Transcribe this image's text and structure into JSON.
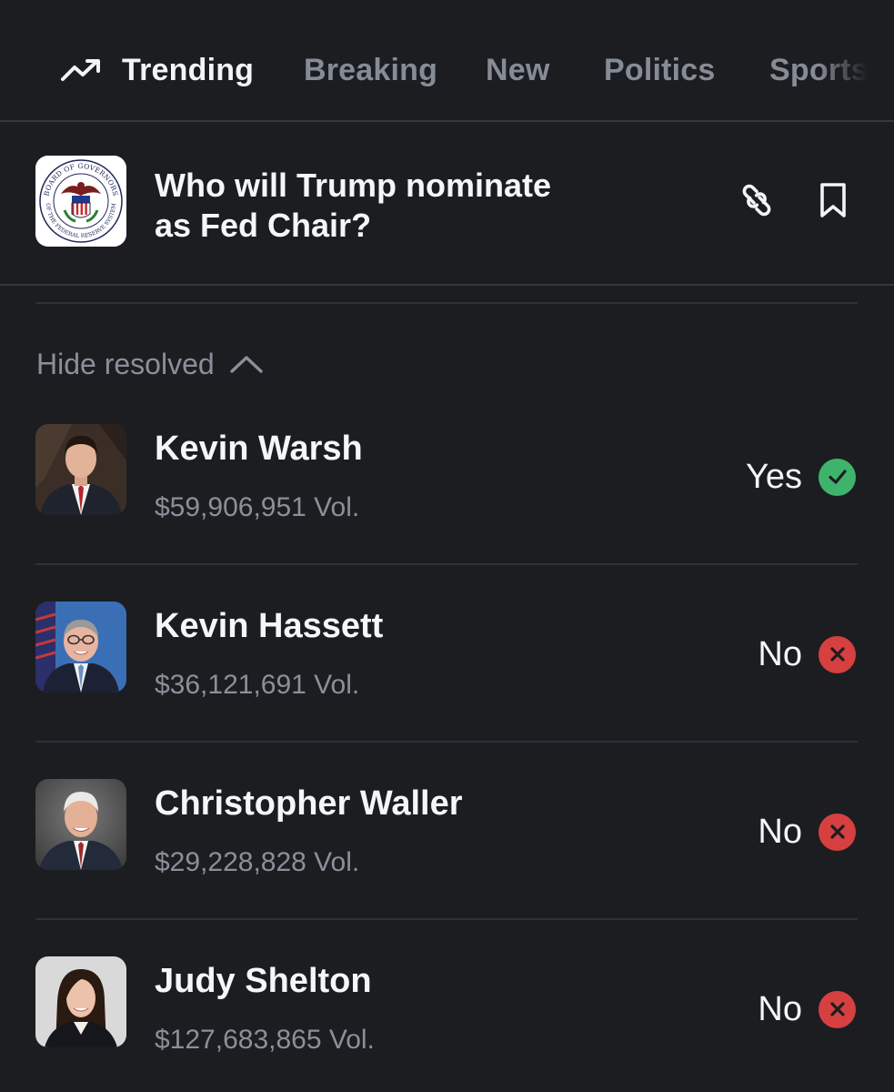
{
  "tabs": [
    {
      "label": "Trending",
      "active": true,
      "icon": "trending-up-icon"
    },
    {
      "label": "Breaking",
      "active": false
    },
    {
      "label": "New",
      "active": false
    },
    {
      "label": "Politics",
      "active": false
    },
    {
      "label": "Sports",
      "active": false
    }
  ],
  "market": {
    "title": "Who will Trump nominate as Fed Chair?",
    "logo": "federal-reserve-seal",
    "logo_text_top": "BOARD OF GOVERNORS",
    "logo_text_bottom": "OF THE FEDERAL RESERVE SYSTEM",
    "actions": [
      "link-icon",
      "bookmark-icon"
    ]
  },
  "filter": {
    "label": "Hide resolved",
    "icon": "chevron-up-icon"
  },
  "outcomes": [
    {
      "name": "Kevin Warsh",
      "volume": "$59,906,951 Vol.",
      "result": "Yes",
      "status": "resolved-yes"
    },
    {
      "name": "Kevin Hassett",
      "volume": "$36,121,691 Vol.",
      "result": "No",
      "status": "resolved-no"
    },
    {
      "name": "Christopher Waller",
      "volume": "$29,228,828 Vol.",
      "result": "No",
      "status": "resolved-no"
    },
    {
      "name": "Judy Shelton",
      "volume": "$127,683,865 Vol.",
      "result": "No",
      "status": "resolved-no"
    }
  ],
  "colors": {
    "background": "#1b1d21",
    "yes": "#3fb36b",
    "no": "#d64040",
    "muted_text": "#8a909a",
    "divider": "#2e3136"
  }
}
